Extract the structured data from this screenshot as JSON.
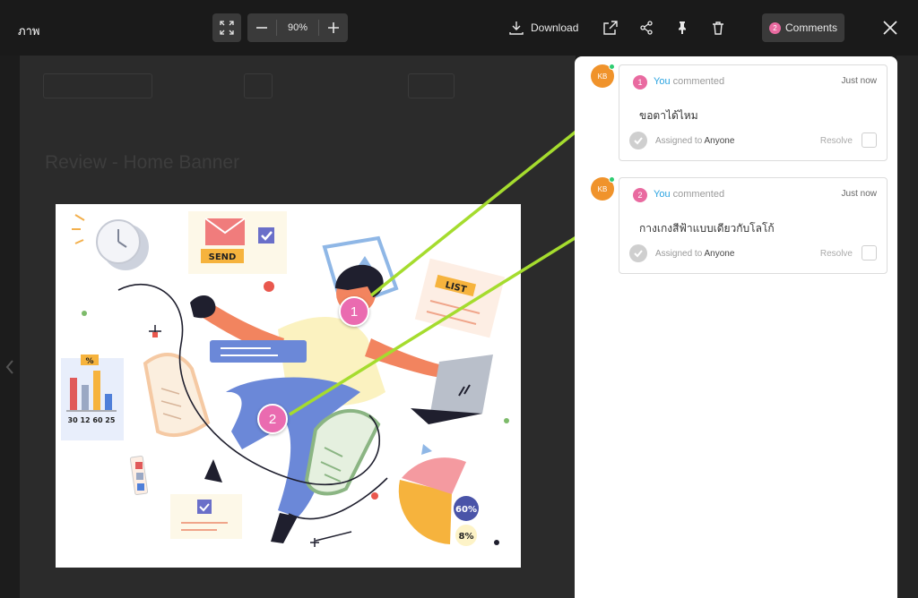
{
  "header": {
    "title": "ภาพ",
    "zoom": "90%",
    "download_label": "Download",
    "comments_label": "Comments",
    "comments_count": "2"
  },
  "background": {
    "heading": "Review - Home Banner"
  },
  "markers": [
    "1",
    "2"
  ],
  "comments": [
    {
      "number": "1",
      "avatar": "KB",
      "author": "You",
      "action": "commented",
      "time": "Just now",
      "text": "ขอตาได้ไหม",
      "assigned_prefix": "Assigned to",
      "assignee": "Anyone",
      "resolve_label": "Resolve"
    },
    {
      "number": "2",
      "avatar": "KB",
      "author": "You",
      "action": "commented",
      "time": "Just now",
      "text": "กางเกงสีฟ้าแบบเดียวกับโลโก้",
      "assigned_prefix": "Assigned to",
      "assignee": "Anyone",
      "resolve_label": "Resolve"
    }
  ],
  "illustration": {
    "envelope_text": "SEND",
    "list_text": "LIST",
    "chart_badge": "%",
    "chart_numbers": "30 12 60 25",
    "percent_60": "60%",
    "percent_8": "8%"
  },
  "colors": {
    "accent": "#e96aa0",
    "arrow": "#a5dc2e",
    "link": "#2aa3e0",
    "avatar": "#f0932b"
  }
}
